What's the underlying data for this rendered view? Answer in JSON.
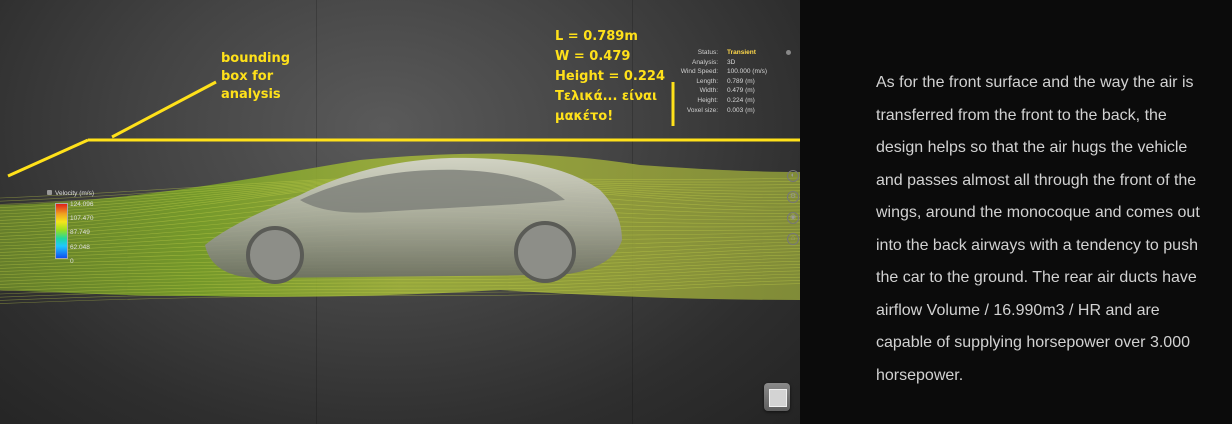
{
  "viewport": {
    "notes": {
      "bounding_box": [
        "bounding",
        "box for",
        "analysis"
      ],
      "dimensions": [
        "L = 0.789m",
        "W = 0.479",
        "Height = 0.224",
        "Τελικά... είναι",
        "μακέτο!"
      ]
    },
    "status_panel": {
      "rows": [
        {
          "key": "Status:",
          "value": "Transient"
        },
        {
          "key": "Analysis:",
          "value": "3D"
        },
        {
          "key": "Wind Speed:",
          "value": "100.000 (m/s)"
        },
        {
          "key": "Length:",
          "value": "0.789 (m)"
        },
        {
          "key": "Width:",
          "value": "0.479 (m)"
        },
        {
          "key": "Height:",
          "value": "0.224 (m)"
        },
        {
          "key": "Voxel size:",
          "value": "0.003 (m)"
        }
      ]
    },
    "legend": {
      "title": "Velocity (m/s)",
      "ticks": [
        "124.096",
        "107.470",
        "87.749",
        "62.048",
        "0"
      ]
    },
    "annotation_color": "#ffe11a"
  },
  "article": {
    "text": "As for the front surface and the way the air is transferred from the front to the back, the design helps so that the air hugs the vehicle and passes almost all through the front of the wings, around the monocoque and comes out into the back airways with a tendency to push the car to the ground. The rear air ducts have airflow Volume / 16.990m3 / HR and are capable of supplying horsepower over 3.000 horsepower."
  }
}
